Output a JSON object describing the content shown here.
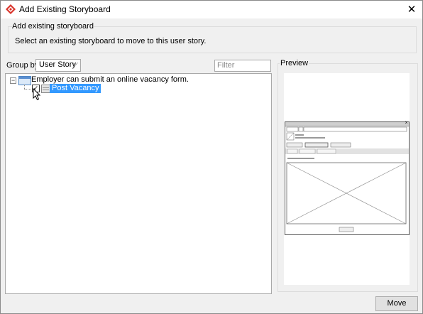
{
  "window": {
    "title": "Add Existing Storyboard"
  },
  "group": {
    "title": "Add existing storyboard",
    "description": "Select an existing storyboard to move to this user story."
  },
  "groupby": {
    "label": "Group by:",
    "value": "User Story"
  },
  "filter": {
    "placeholder": "Filter"
  },
  "tree": {
    "root_label": "Employer can submit an online vacancy form.",
    "child_label": "Post Vacancy",
    "child_checked": true
  },
  "preview": {
    "title": "Preview"
  },
  "buttons": {
    "move": "Move"
  },
  "colors": {
    "selection": "#3399ff",
    "window_bg": "#f0f0f0"
  }
}
